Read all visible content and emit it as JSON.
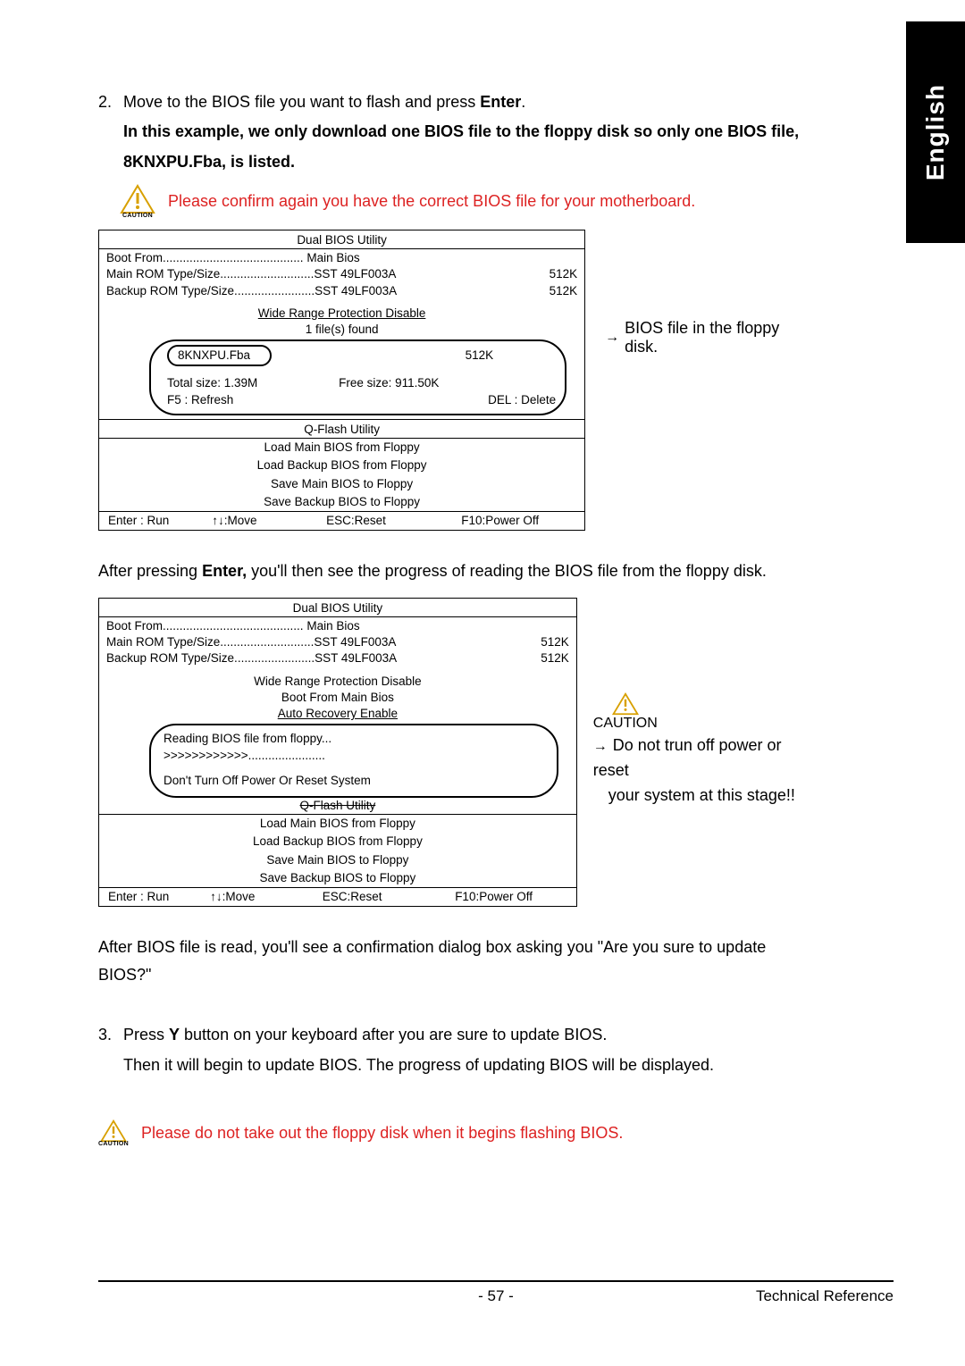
{
  "side_tab": "English",
  "step2": {
    "num": "2.",
    "text_a": "Move to the BIOS file you want to flash and press ",
    "enter": "Enter",
    "period": ".",
    "bold_line": "In this example, we only download one BIOS file to the floppy disk so only one BIOS file, 8KNXPU.Fba, is listed."
  },
  "caution1": {
    "label": "CAUTION",
    "text": "Please confirm again you have the correct BIOS file for your motherboard."
  },
  "caution2": {
    "label": "CAUTION",
    "text": "Please do not take out the floppy disk when it begins flashing BIOS."
  },
  "caution3_label": "CAUTION",
  "bios1": {
    "title": "Dual BIOS Utility",
    "boot_from_label": "Boot From..........................................",
    "boot_from_val": "Main Bios",
    "main_rom_label": "Main ROM Type/Size............................",
    "main_rom_val": "SST 49LF003A",
    "main_rom_size": "512K",
    "backup_rom_label": "Backup ROM Type/Size........................",
    "backup_rom_val": "SST 49LF003A",
    "backup_rom_size": "512K",
    "wide_range": "Wide Range Protection    Disable",
    "files_found": "1  file(s) found",
    "file_name": "8KNXPU.Fba",
    "file_size": "512K",
    "total_size": "Total size: 1.39M",
    "free_size": "Free size: 911.50K",
    "refresh": "F5 : Refresh",
    "delete": "DEL : Delete",
    "qflash": "Q-Flash Utility",
    "load_main": "Load Main BIOS from Floppy",
    "load_backup": "Load Backup BIOS from Floppy",
    "save_main": "Save Main BIOS to Floppy",
    "save_backup": "Save Backup BIOS to Floppy",
    "k_enter": "Enter : Run",
    "k_move": "↑↓:Move",
    "k_esc": "ESC:Reset",
    "k_f10": "F10:Power Off"
  },
  "note1": "BIOS file in the floppy disk.",
  "after1_a": "After pressing ",
  "after1_b": "Enter,",
  "after1_c": " you'll then see the progress of reading the BIOS file from the floppy disk.",
  "bios2": {
    "title": "Dual BIOS Utility",
    "boot_from_label": "Boot From..........................................",
    "boot_from_val": "Main Bios",
    "main_rom_label": "Main ROM Type/Size............................",
    "main_rom_val": "SST 49LF003A",
    "main_rom_size": "512K",
    "backup_rom_label": "Backup ROM Type/Size........................",
    "backup_rom_val": "SST 49LF003A",
    "backup_rom_size": "512K",
    "wide_range": "Wide Range Protection    Disable",
    "boot_from2": "Boot From    Main Bios",
    "auto_recovery": "Auto Recovery    Enable",
    "reading": "Reading BIOS file from floppy...",
    "chevrons": ">>>>>>>>>>>>.......................",
    "dont_off": "Don't Turn Off Power Or Reset System",
    "qflash": "Q-Flash Utility",
    "load_main": "Load Main BIOS from Floppy",
    "load_backup": "Load Backup BIOS from Floppy",
    "save_main": "Save Main BIOS to Floppy",
    "save_backup": "Save Backup BIOS to Floppy",
    "k_enter": "Enter : Run",
    "k_move": "↑↓:Move",
    "k_esc": "ESC:Reset",
    "k_f10": "F10:Power Off"
  },
  "note2_a": "Do not trun off power or reset",
  "note2_b": "your system at this stage!!",
  "after2": "After BIOS file is read, you'll see a confirmation dialog box asking you \"Are you sure to update BIOS?\"",
  "step3": {
    "num": "3.",
    "line1_a": "Press ",
    "line1_y": "Y",
    "line1_b": " button on your keyboard after you are sure to update BIOS.",
    "line2": "Then it will begin to update BIOS. The progress of updating BIOS will be displayed."
  },
  "footer": {
    "page": "- 57 -",
    "ref": "Technical Reference"
  }
}
